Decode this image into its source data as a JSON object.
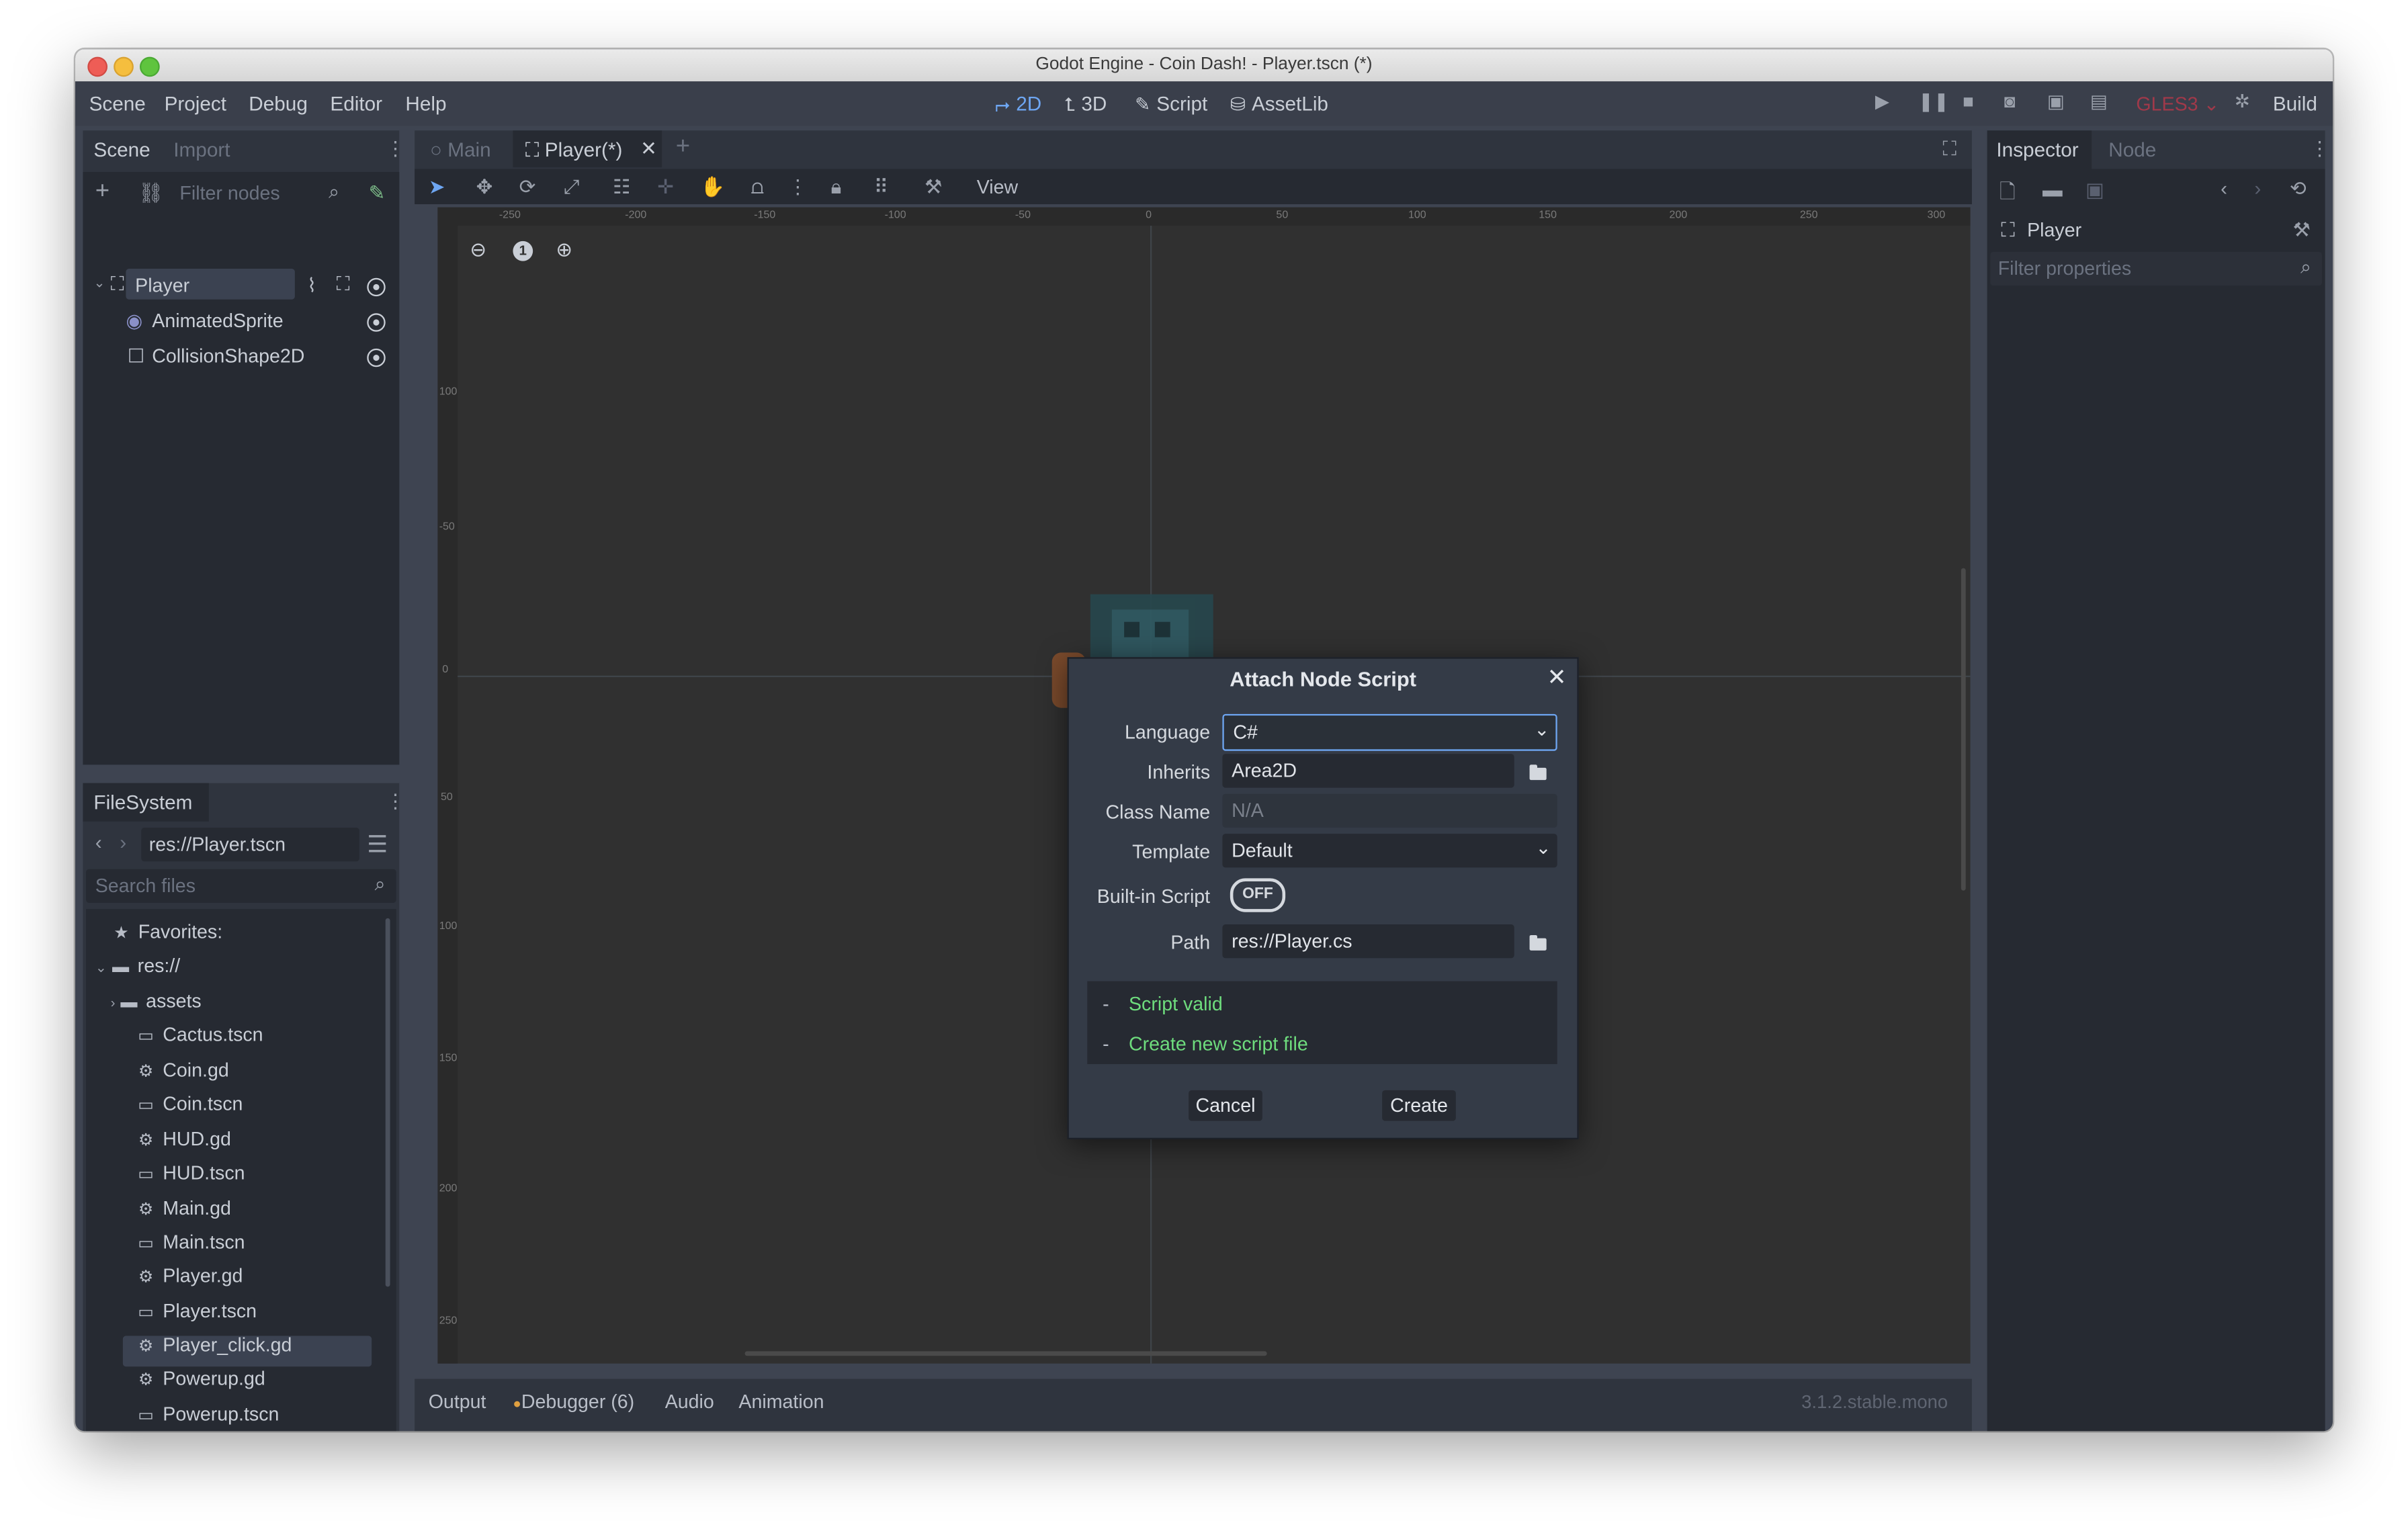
{
  "window": {
    "title": "Godot Engine - Coin Dash! - Player.tscn (*)"
  },
  "menubar": {
    "menus": [
      "Scene",
      "Project",
      "Debug",
      "Editor",
      "Help"
    ],
    "workspaces": [
      {
        "label": "2D",
        "icon": "2d-icon"
      },
      {
        "label": "3D",
        "icon": "3d-icon"
      },
      {
        "label": "Script",
        "icon": "script-icon"
      },
      {
        "label": "AssetLib",
        "icon": "assetlib-icon"
      }
    ],
    "renderer": "GLES3",
    "build_label": "Build"
  },
  "scene_dock": {
    "tabs": [
      "Scene",
      "Import"
    ],
    "filter_placeholder": "Filter nodes",
    "nodes": [
      {
        "name": "Player",
        "icon": "area2d-icon"
      },
      {
        "name": "AnimatedSprite",
        "icon": "animated-sprite-icon"
      },
      {
        "name": "CollisionShape2D",
        "icon": "collision-shape-icon"
      }
    ]
  },
  "filesystem_dock": {
    "tab": "FileSystem",
    "path": "res://Player.tscn",
    "search_placeholder": "Search files",
    "favorites_label": "Favorites:",
    "root_label": "res://",
    "items": [
      {
        "name": "assets",
        "type": "folder"
      },
      {
        "name": "Cactus.tscn",
        "type": "scene"
      },
      {
        "name": "Coin.gd",
        "type": "script"
      },
      {
        "name": "Coin.tscn",
        "type": "scene"
      },
      {
        "name": "HUD.gd",
        "type": "script"
      },
      {
        "name": "HUD.tscn",
        "type": "scene"
      },
      {
        "name": "Main.gd",
        "type": "script"
      },
      {
        "name": "Main.tscn",
        "type": "scene"
      },
      {
        "name": "Player.gd",
        "type": "script"
      },
      {
        "name": "Player.tscn",
        "type": "scene",
        "selected": true
      },
      {
        "name": "Player_click.gd",
        "type": "script"
      },
      {
        "name": "Powerup.gd",
        "type": "script"
      },
      {
        "name": "Powerup.tscn",
        "type": "scene"
      }
    ]
  },
  "editor_tabs": [
    "Main",
    "Player(*)"
  ],
  "toolbar": {
    "view_label": "View"
  },
  "ruler": {
    "top_ticks": [
      "-250",
      "-200",
      "-150",
      "-100",
      "-50",
      "0",
      "50",
      "100",
      "150",
      "200",
      "250",
      "300"
    ],
    "left_ticks": [
      "100",
      "-50",
      "0",
      "50",
      "100",
      "150",
      "200",
      "250"
    ]
  },
  "zoom": {
    "reset_label": "1"
  },
  "dialog": {
    "title": "Attach Node Script",
    "language_label": "Language",
    "language_value": "C#",
    "inherits_label": "Inherits",
    "inherits_value": "Area2D",
    "class_name_label": "Class Name",
    "class_name_placeholder": "N/A",
    "template_label": "Template",
    "template_value": "Default",
    "builtin_label": "Built-in Script",
    "builtin_value": "OFF",
    "path_label": "Path",
    "path_value": "res://Player.cs",
    "messages": [
      "Script valid",
      "Create new script file"
    ],
    "cancel_label": "Cancel",
    "create_label": "Create"
  },
  "bottom_panel": {
    "tabs": [
      "Output",
      "Debugger (6)",
      "Audio",
      "Animation"
    ],
    "version": "3.1.2.stable.mono"
  },
  "inspector": {
    "tabs": [
      "Inspector",
      "Node"
    ],
    "object_label": "Player",
    "filter_placeholder": "Filter properties"
  },
  "colors": {
    "accent": "#6ea6f2",
    "valid_text": "#6edc7d",
    "renderer_red": "#a0394a",
    "panel": "#2f343e",
    "viewport": "#303030"
  }
}
